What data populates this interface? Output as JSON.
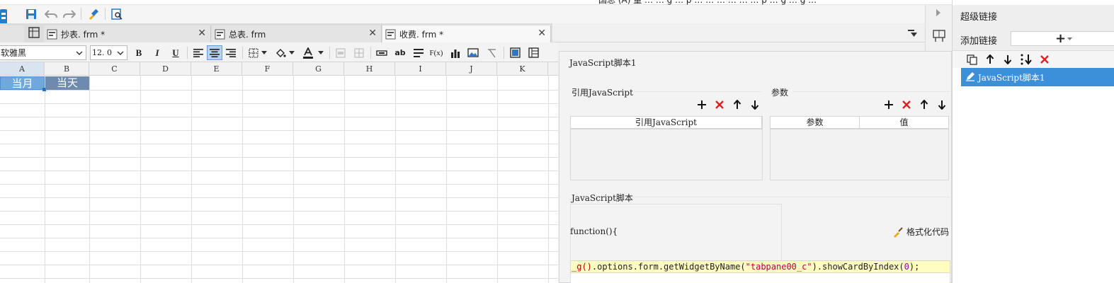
{
  "top_strip_partial_text": "国总 (A) 量 … … g … p … … … … … … p … g … g …",
  "tabs": [
    {
      "label": "抄表. frm *",
      "close": "✕"
    },
    {
      "label": "总表. frm",
      "close": "✕"
    },
    {
      "label": "收费. frm *",
      "close": "✕"
    }
  ],
  "format_bar": {
    "font_name": "软雅黑",
    "font_size": "12. 0",
    "bold": "B",
    "italic": "I",
    "underline": "U",
    "text_ab": "ab",
    "fx": "F(x)"
  },
  "grid": {
    "columns": [
      "A",
      "B",
      "C",
      "D",
      "E",
      "F",
      "G",
      "H",
      "I",
      "J",
      "K"
    ],
    "cells": {
      "A1": "当月",
      "B1": "当天"
    }
  },
  "js_dialog": {
    "title": "JavaScript脚本1",
    "ref_section": {
      "label": "引用JavaScript",
      "column": "引用JavaScript"
    },
    "param_section": {
      "label": "参数",
      "columns": [
        "参数",
        "值"
      ]
    },
    "script_section": {
      "label": "JavaScript脚本"
    },
    "func_header": "function(){",
    "format_code": "格式化代码",
    "code": {
      "p1": "_g",
      "p2": "()",
      "p3": ".options.form.getWidgetByName(",
      "p4": "\"tabpane00_c\"",
      "p5": ").showCardByIndex(",
      "p6": "0",
      "p7": ");"
    }
  },
  "right_panel": {
    "title": "超级链接",
    "add_link_label": "添加链接",
    "add_symbol": "+",
    "items": [
      "JavaScript脚本1"
    ]
  },
  "colors": {
    "selected_item": "#3b90d9",
    "cell_a": "#6ea8dc",
    "cell_b": "#6e8bad",
    "delete_red": "#e02020",
    "code_bg": "#fffdbf"
  }
}
